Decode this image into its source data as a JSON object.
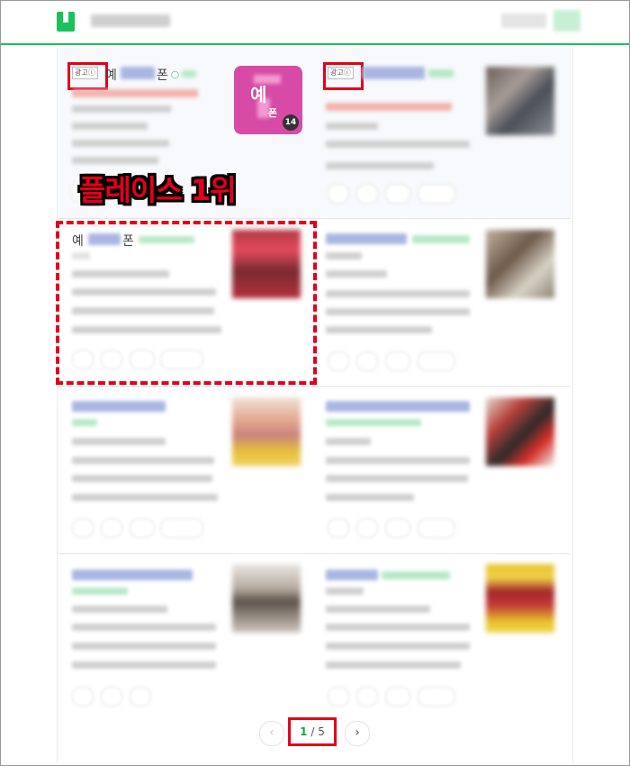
{
  "ad_badge_label": "광고",
  "first_ad": {
    "title_start": "예",
    "title_end": "폰",
    "tile_char_1": "예",
    "tile_char_2": "폰",
    "review_count": "14"
  },
  "overlay_label": "플레이스 1위",
  "first_organic": {
    "title_start": "예",
    "title_end": "폰"
  },
  "pagination": {
    "current": "1",
    "total": "5",
    "separator": "/",
    "prev_icon": "‹",
    "next_icon": "›"
  },
  "colors": {
    "brand_green": "#19c25a",
    "highlight_red": "#e4001b",
    "tile_pink": "#d74aa5"
  }
}
